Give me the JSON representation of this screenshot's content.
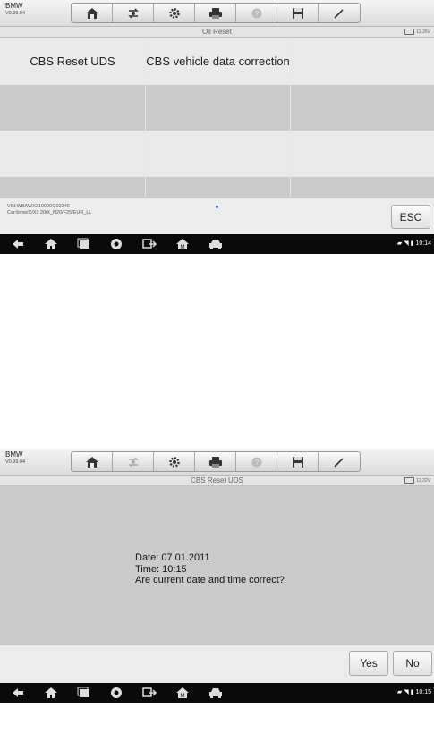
{
  "app": {
    "make": "BMW",
    "version": "V0.99.04",
    "toolbar_icons": [
      "home-icon",
      "vehicle-swap-icon",
      "settings-icon",
      "print-icon",
      "help-icon",
      "save-icon",
      "edit-icon"
    ]
  },
  "screen1": {
    "title": "Oil Reset",
    "battery": "12.26V",
    "menu": [
      [
        "CBS Reset UDS",
        "CBS vehicle data correction",
        ""
      ],
      [
        "",
        "",
        ""
      ],
      [
        "",
        "",
        ""
      ],
      [
        "",
        "",
        ""
      ]
    ],
    "vin_line": "VIN:WBAWX310000G02246",
    "car_line": "Car:bmw/X/X3 20iX_N20/F25/EUR_LL",
    "esc_label": "ESC",
    "clock": "10:14"
  },
  "screen2": {
    "title": "CBS Reset UDS",
    "battery": "12.22V",
    "message_lines": [
      "Date: 07.01.2011",
      "Time: 10:15",
      "Are current date and time correct?"
    ],
    "yes_label": "Yes",
    "no_label": "No",
    "clock": "10:15"
  },
  "navbar_icons": [
    "back-icon",
    "home-icon",
    "recent-apps-icon",
    "browser-icon",
    "vci-icon",
    "maxifix-icon",
    "car-icon"
  ],
  "colors": {
    "accent_dot": "#2a73c8",
    "navbar": "#0a0a0a",
    "panel": "#cbcbcb"
  }
}
